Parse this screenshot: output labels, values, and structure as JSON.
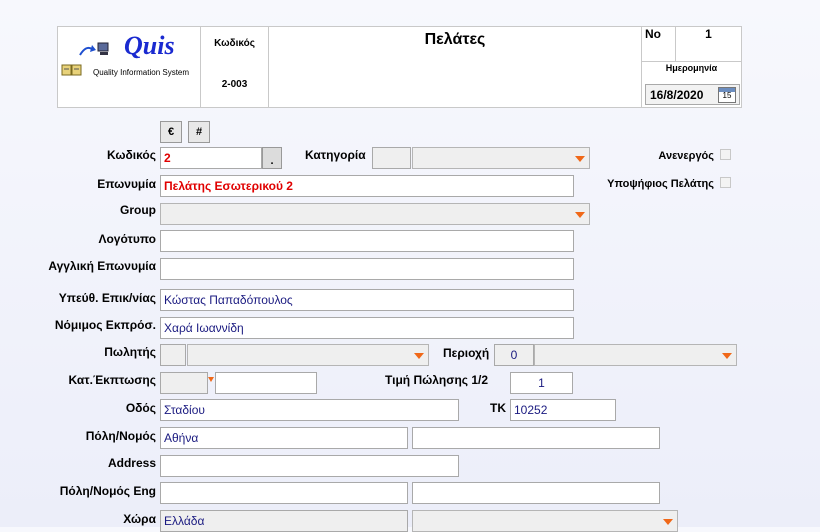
{
  "header": {
    "logo_text": "Quis",
    "logo_subtitle": "Quality Information System",
    "code_label": "Κωδικός",
    "code_value": "2-003",
    "title": "Πελάτες",
    "no_label": "No",
    "no_value": "1",
    "date_label": "Ημερομηνία",
    "date_value": "16/8/2020",
    "calendar_day": "15"
  },
  "toolbar": {
    "euro_label": "€",
    "hash_label": "#"
  },
  "form": {
    "kodikos": {
      "label": "Κωδικός",
      "value": "2",
      "button_label": "."
    },
    "katigoria": {
      "label": "Κατηγορία",
      "code": "",
      "value": ""
    },
    "anenergos": {
      "label": "Ανενεργός"
    },
    "eponymia": {
      "label": "Επωνυμία",
      "value": "Πελάτης Εσωτερικού 2"
    },
    "ypopsifios": {
      "label": "Υποψήφιος Πελάτης"
    },
    "group": {
      "label": "Group",
      "value": ""
    },
    "logotypo": {
      "label": "Λογότυπο",
      "value": ""
    },
    "english_name": {
      "label": "Αγγλική Επωνυμία",
      "value": ""
    },
    "contact": {
      "label": "Υπεύθ. Επικ/νίας",
      "value": "Κώστας Παπαδόπουλος"
    },
    "legal_rep": {
      "label": "Νόμιμος Εκπρόσ.",
      "value": "Χαρά Ιωαννίδη"
    },
    "salesman": {
      "label": "Πωλητής",
      "code": "",
      "value": ""
    },
    "region": {
      "label": "Περιοχή",
      "code": "0",
      "value": ""
    },
    "discount_cat": {
      "label": "Κατ.Έκπτωσης",
      "code": "",
      "value": ""
    },
    "sale_price": {
      "label": "Τιμή Πώλησης 1/2",
      "value": "1"
    },
    "street": {
      "label": "Οδός",
      "value": "Σταδίου"
    },
    "tk": {
      "label": "ΤΚ",
      "value": "10252"
    },
    "city": {
      "label": "Πόλη/Νομός",
      "value": "Αθήνα",
      "value2": ""
    },
    "address": {
      "label": "Address",
      "value": ""
    },
    "city_eng": {
      "label": "Πόλη/Νομός Eng",
      "value": "",
      "value2": ""
    },
    "country": {
      "label": "Χώρα",
      "value": "Ελλάδα",
      "value2": ""
    }
  },
  "colors": {
    "dropdown_arrow": "#f06818",
    "value_text": "#1a1a80",
    "red_text": "#e00000"
  }
}
